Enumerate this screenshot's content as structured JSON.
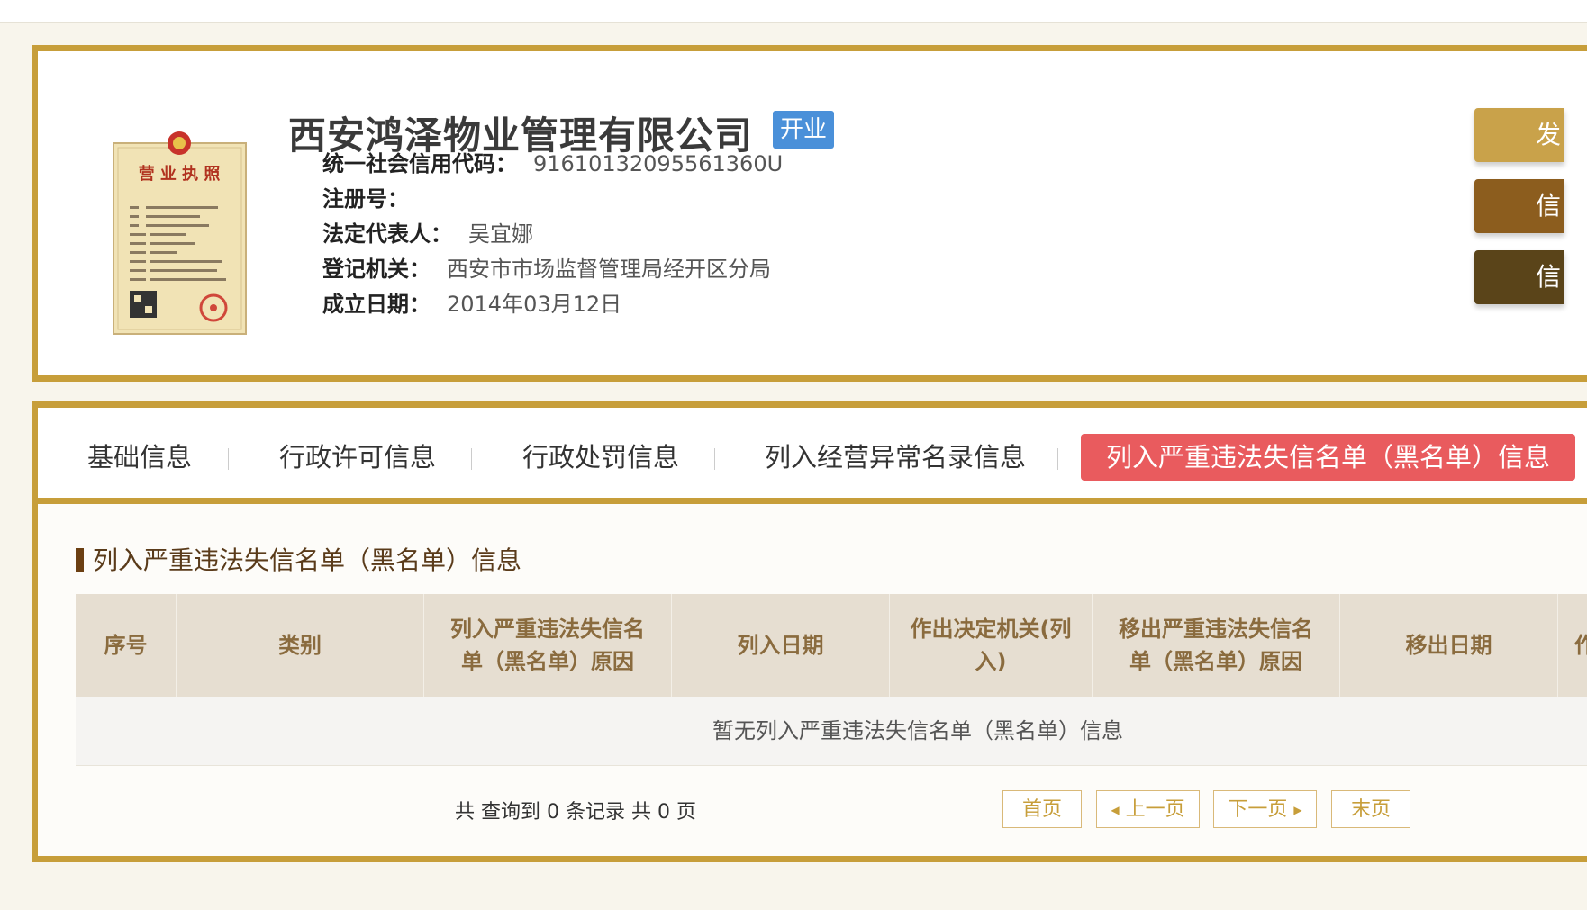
{
  "company": {
    "name": "西安鸿泽物业管理有限公司",
    "status": "开业",
    "fields": [
      {
        "label": "统一社会信用代码：",
        "value": "91610132095561360U"
      },
      {
        "label": "注册号：",
        "value": ""
      },
      {
        "label": "法定代表人：",
        "value": "吴宜娜"
      },
      {
        "label": "登记机关：",
        "value": "西安市市场监督管理局经开区分局"
      },
      {
        "label": "成立日期：",
        "value": "2014年03月12日"
      }
    ],
    "license_image": {
      "title": "营 业 执 照"
    }
  },
  "side_buttons": [
    {
      "label": "发",
      "color": "#c9a24a"
    },
    {
      "label": "信",
      "color": "#8c5d1e"
    },
    {
      "label": "信",
      "color": "#5a4419"
    }
  ],
  "tabs": [
    {
      "label": "基础信息",
      "active": false
    },
    {
      "label": "行政许可信息",
      "active": false
    },
    {
      "label": "行政处罚信息",
      "active": false
    },
    {
      "label": "列入经营异常名录信息",
      "active": false
    },
    {
      "label": "列入严重违法失信名单（黑名单）信息",
      "active": true
    }
  ],
  "section": {
    "title": "列入严重违法失信名单（黑名单）信息"
  },
  "table": {
    "headers": [
      [
        "序号"
      ],
      [
        "类别"
      ],
      [
        "列入严重违法失信名",
        "单（黑名单）原因"
      ],
      [
        "列入日期"
      ],
      [
        "作出决定机关(列",
        "入)"
      ],
      [
        "移出严重违法失信名",
        "单（黑名单）原因"
      ],
      [
        "移出日期"
      ],
      [
        "作"
      ]
    ],
    "empty_text": "暂无列入严重违法失信名单（黑名单）信息"
  },
  "pagination": {
    "summary": "共 查询到 0 条记录 共 0 页",
    "first": "首页",
    "prev": "上一页",
    "next": "下一页",
    "last": "末页"
  },
  "colors": {
    "border_gold": "#c79e3a",
    "active_tab": "#e95b5e",
    "status_badge": "#4a90d9"
  }
}
